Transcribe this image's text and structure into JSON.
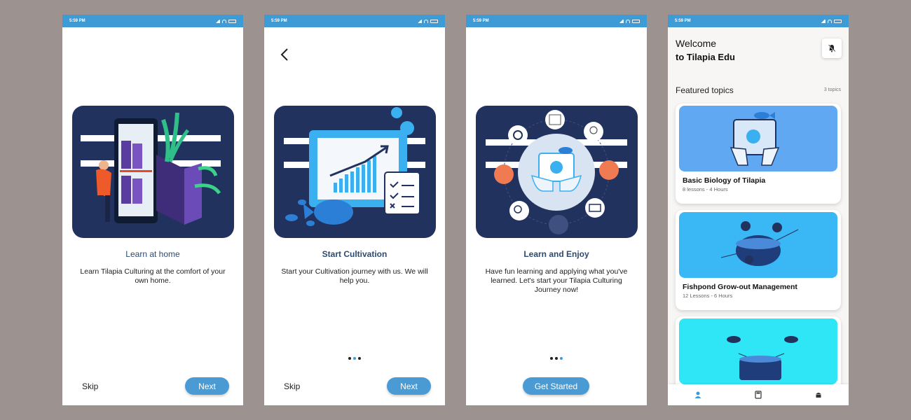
{
  "status_time": "5:59 PM",
  "screen1": {
    "title": "Learn at home",
    "description": "Learn Tilapia Culturing at the comfort of your own home.",
    "skip_label": "Skip",
    "next_label": "Next"
  },
  "screen2": {
    "title": "Start Cultivation",
    "description": "Start your Cultivation journey with us. We will help you.",
    "skip_label": "Skip",
    "next_label": "Next"
  },
  "screen3": {
    "title": "Learn and Enjoy",
    "description": "Have fun learning and applying what you've learned. Let's start your Tilapia Culturing Journey now!",
    "cta_label": "Get Started"
  },
  "home": {
    "welcome_line1": "Welcome",
    "welcome_line2": "to Tilapia Edu",
    "featured_label": "Featured topics",
    "topic_count": "3 topics",
    "topics": [
      {
        "title": "Basic Biology of Tilapia",
        "meta": "8 lessons - 4 Hours",
        "color": "#61a8f3"
      },
      {
        "title": "Fishpond Grow-out Management",
        "meta": "12 Lessons - 6 Hours",
        "color": "#3ab8f5"
      },
      {
        "title": "",
        "meta": "",
        "color": "#2fe6f7"
      }
    ]
  },
  "colors": {
    "accent": "#4a9ad4",
    "statusbar": "#3e9bd6",
    "illustration_bg": "#22325e",
    "background": "#9c9290"
  }
}
